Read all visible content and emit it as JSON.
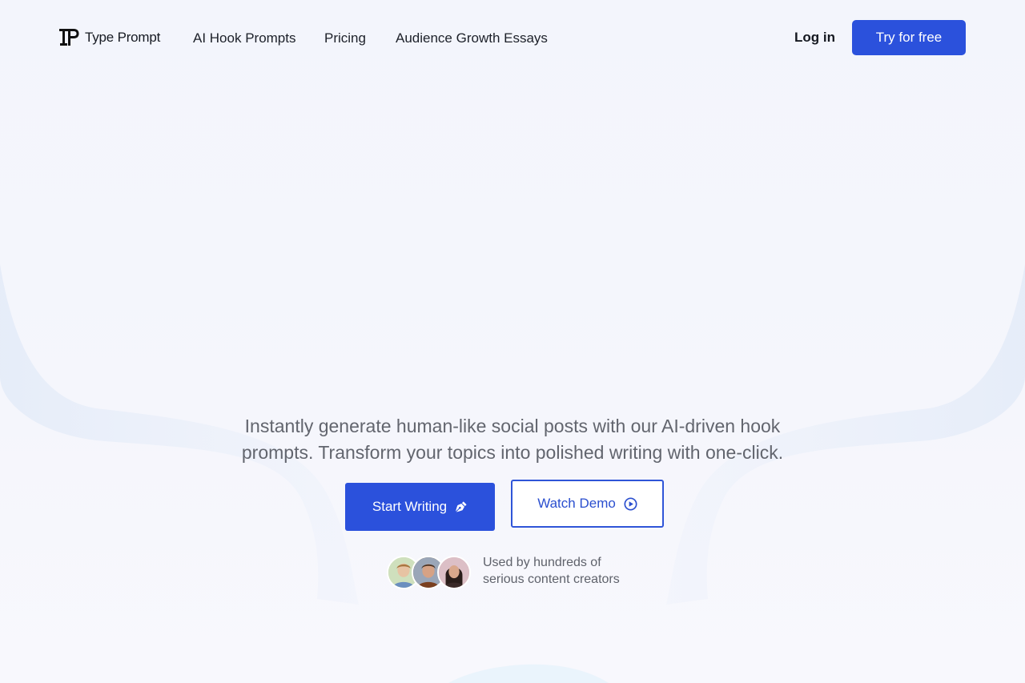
{
  "nav": {
    "brand": "Type Prompt",
    "links": [
      "AI Hook Prompts",
      "Pricing",
      "Audience Growth Essays"
    ],
    "login_label": "Log in",
    "cta_label": "Try for free"
  },
  "hero": {
    "line1": "Instantly generate human-like social posts with our AI-driven hook",
    "line2": "prompts. Transform your topics into polished writing with one-click.",
    "primary_button": "Start Writing",
    "secondary_button": "Watch Demo"
  },
  "social_proof": {
    "line1": "Used by hundreds of",
    "line2": "serious content creators",
    "avatars": [
      "avatar-1",
      "avatar-2",
      "avatar-3"
    ]
  },
  "icons": {
    "primary_button_icon": "pen-icon",
    "secondary_button_icon": "play-circle-icon"
  },
  "colors": {
    "accent": "#2b51dc",
    "background": "#f4f6fc",
    "body_text": "#62656e"
  }
}
